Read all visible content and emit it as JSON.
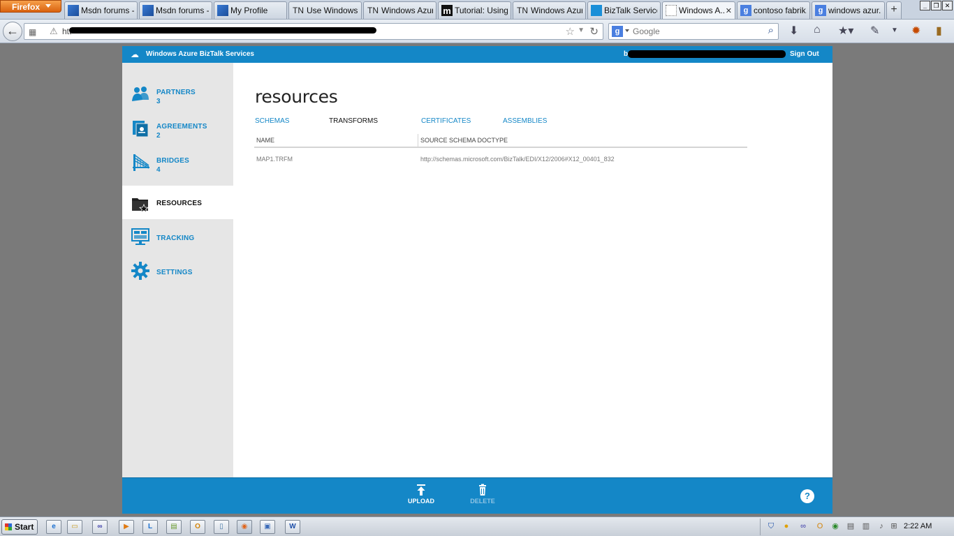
{
  "browser": {
    "app_button": "Firefox",
    "tabs": [
      {
        "icon": "msdn",
        "label": "Msdn forums -..."
      },
      {
        "icon": "msdn",
        "label": "Msdn forums -..."
      },
      {
        "icon": "msdn",
        "label": "My Profile"
      },
      {
        "icon": "tn",
        "label": "Use Windows ..."
      },
      {
        "icon": "tn",
        "label": "Windows Azur..."
      },
      {
        "icon": "m",
        "label": "Tutorial: Using..."
      },
      {
        "icon": "tn",
        "label": "Windows Azur..."
      },
      {
        "icon": "biz",
        "label": "BizTalk Service..."
      },
      {
        "icon": "blank",
        "label": "Windows A..."
      },
      {
        "icon": "g",
        "label": "contoso fabrik..."
      },
      {
        "icon": "g",
        "label": "windows azur..."
      }
    ],
    "tab_icon_text": {
      "tn": "TN",
      "m": "m",
      "g": "g"
    },
    "new_tab": "+",
    "url_visible": "htt",
    "search_placeholder": "Google"
  },
  "app": {
    "title": "Windows Azure BizTalk Services",
    "user_initial": "b",
    "sign_out": "Sign Out"
  },
  "sidebar": {
    "items": [
      {
        "label": "PARTNERS",
        "count": "3",
        "icon": "partners-icon"
      },
      {
        "label": "AGREEMENTS",
        "count": "2",
        "icon": "agreements-icon"
      },
      {
        "label": "BRIDGES",
        "count": "4",
        "icon": "bridges-icon"
      },
      {
        "label": "RESOURCES",
        "count": "",
        "icon": "resources-icon",
        "active": true
      },
      {
        "label": "TRACKING",
        "count": "",
        "icon": "tracking-icon"
      },
      {
        "label": "SETTINGS",
        "count": "",
        "icon": "settings-icon"
      }
    ]
  },
  "main": {
    "title": "resources",
    "tabs": [
      {
        "label": "SCHEMAS"
      },
      {
        "label": "TRANSFORMS",
        "active": true
      },
      {
        "label": "CERTIFICATES"
      },
      {
        "label": "ASSEMBLIES"
      }
    ],
    "columns": [
      "NAME",
      "SOURCE SCHEMA DOCTYPE"
    ],
    "rows": [
      {
        "name": "MAP1.TRFM",
        "doctype": "http://schemas.microsoft.com/BizTalk/EDI/X12/2006#X12_00401_832"
      }
    ]
  },
  "commands": {
    "upload": "UPLOAD",
    "delete": "DELETE",
    "help": "?"
  },
  "taskbar": {
    "start": "Start",
    "clock": "2:22 AM"
  },
  "colors": {
    "accent": "#1487c7",
    "sidebar_bg": "#e6e6e6",
    "page_bg": "#7a7a7a"
  }
}
